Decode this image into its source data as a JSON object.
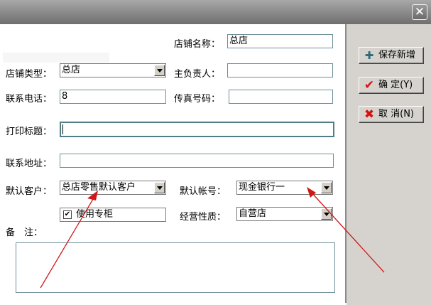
{
  "window": {
    "close_glyph": "✕"
  },
  "form": {
    "store_name": {
      "label": "店铺名称：",
      "value": "总店"
    },
    "store_type": {
      "label": "店铺类型：",
      "value": "总店"
    },
    "manager": {
      "label": "主负责人：",
      "value": ""
    },
    "phone": {
      "label": "联系电话：",
      "value": "8"
    },
    "fax": {
      "label": "传真号码：",
      "value": ""
    },
    "print_title": {
      "label": "打印标题：",
      "value": ""
    },
    "address": {
      "label": "联系地址：",
      "value": ""
    },
    "default_customer": {
      "label": "默认客户：",
      "value": "总店零售默认客户"
    },
    "default_account": {
      "label": "默认帐号：",
      "value": "现金银行一"
    },
    "use_counter": {
      "label": "使用专柜",
      "checked": true
    },
    "business_type": {
      "label": "经营性质：",
      "value": "自营店"
    },
    "remarks": {
      "label": "备　注：",
      "value": ""
    }
  },
  "buttons": {
    "save_new": {
      "label": "保存新增",
      "icon": "plus-icon",
      "color": "#2a6a7a"
    },
    "confirm": {
      "label": "确 定(Y)",
      "icon": "checkmark-icon",
      "color": "#d81010"
    },
    "cancel": {
      "label": "取 消(N)",
      "icon": "x-mark-icon",
      "color": "#d81010"
    }
  },
  "colors": {
    "annotation_arrow": "#d01818"
  }
}
